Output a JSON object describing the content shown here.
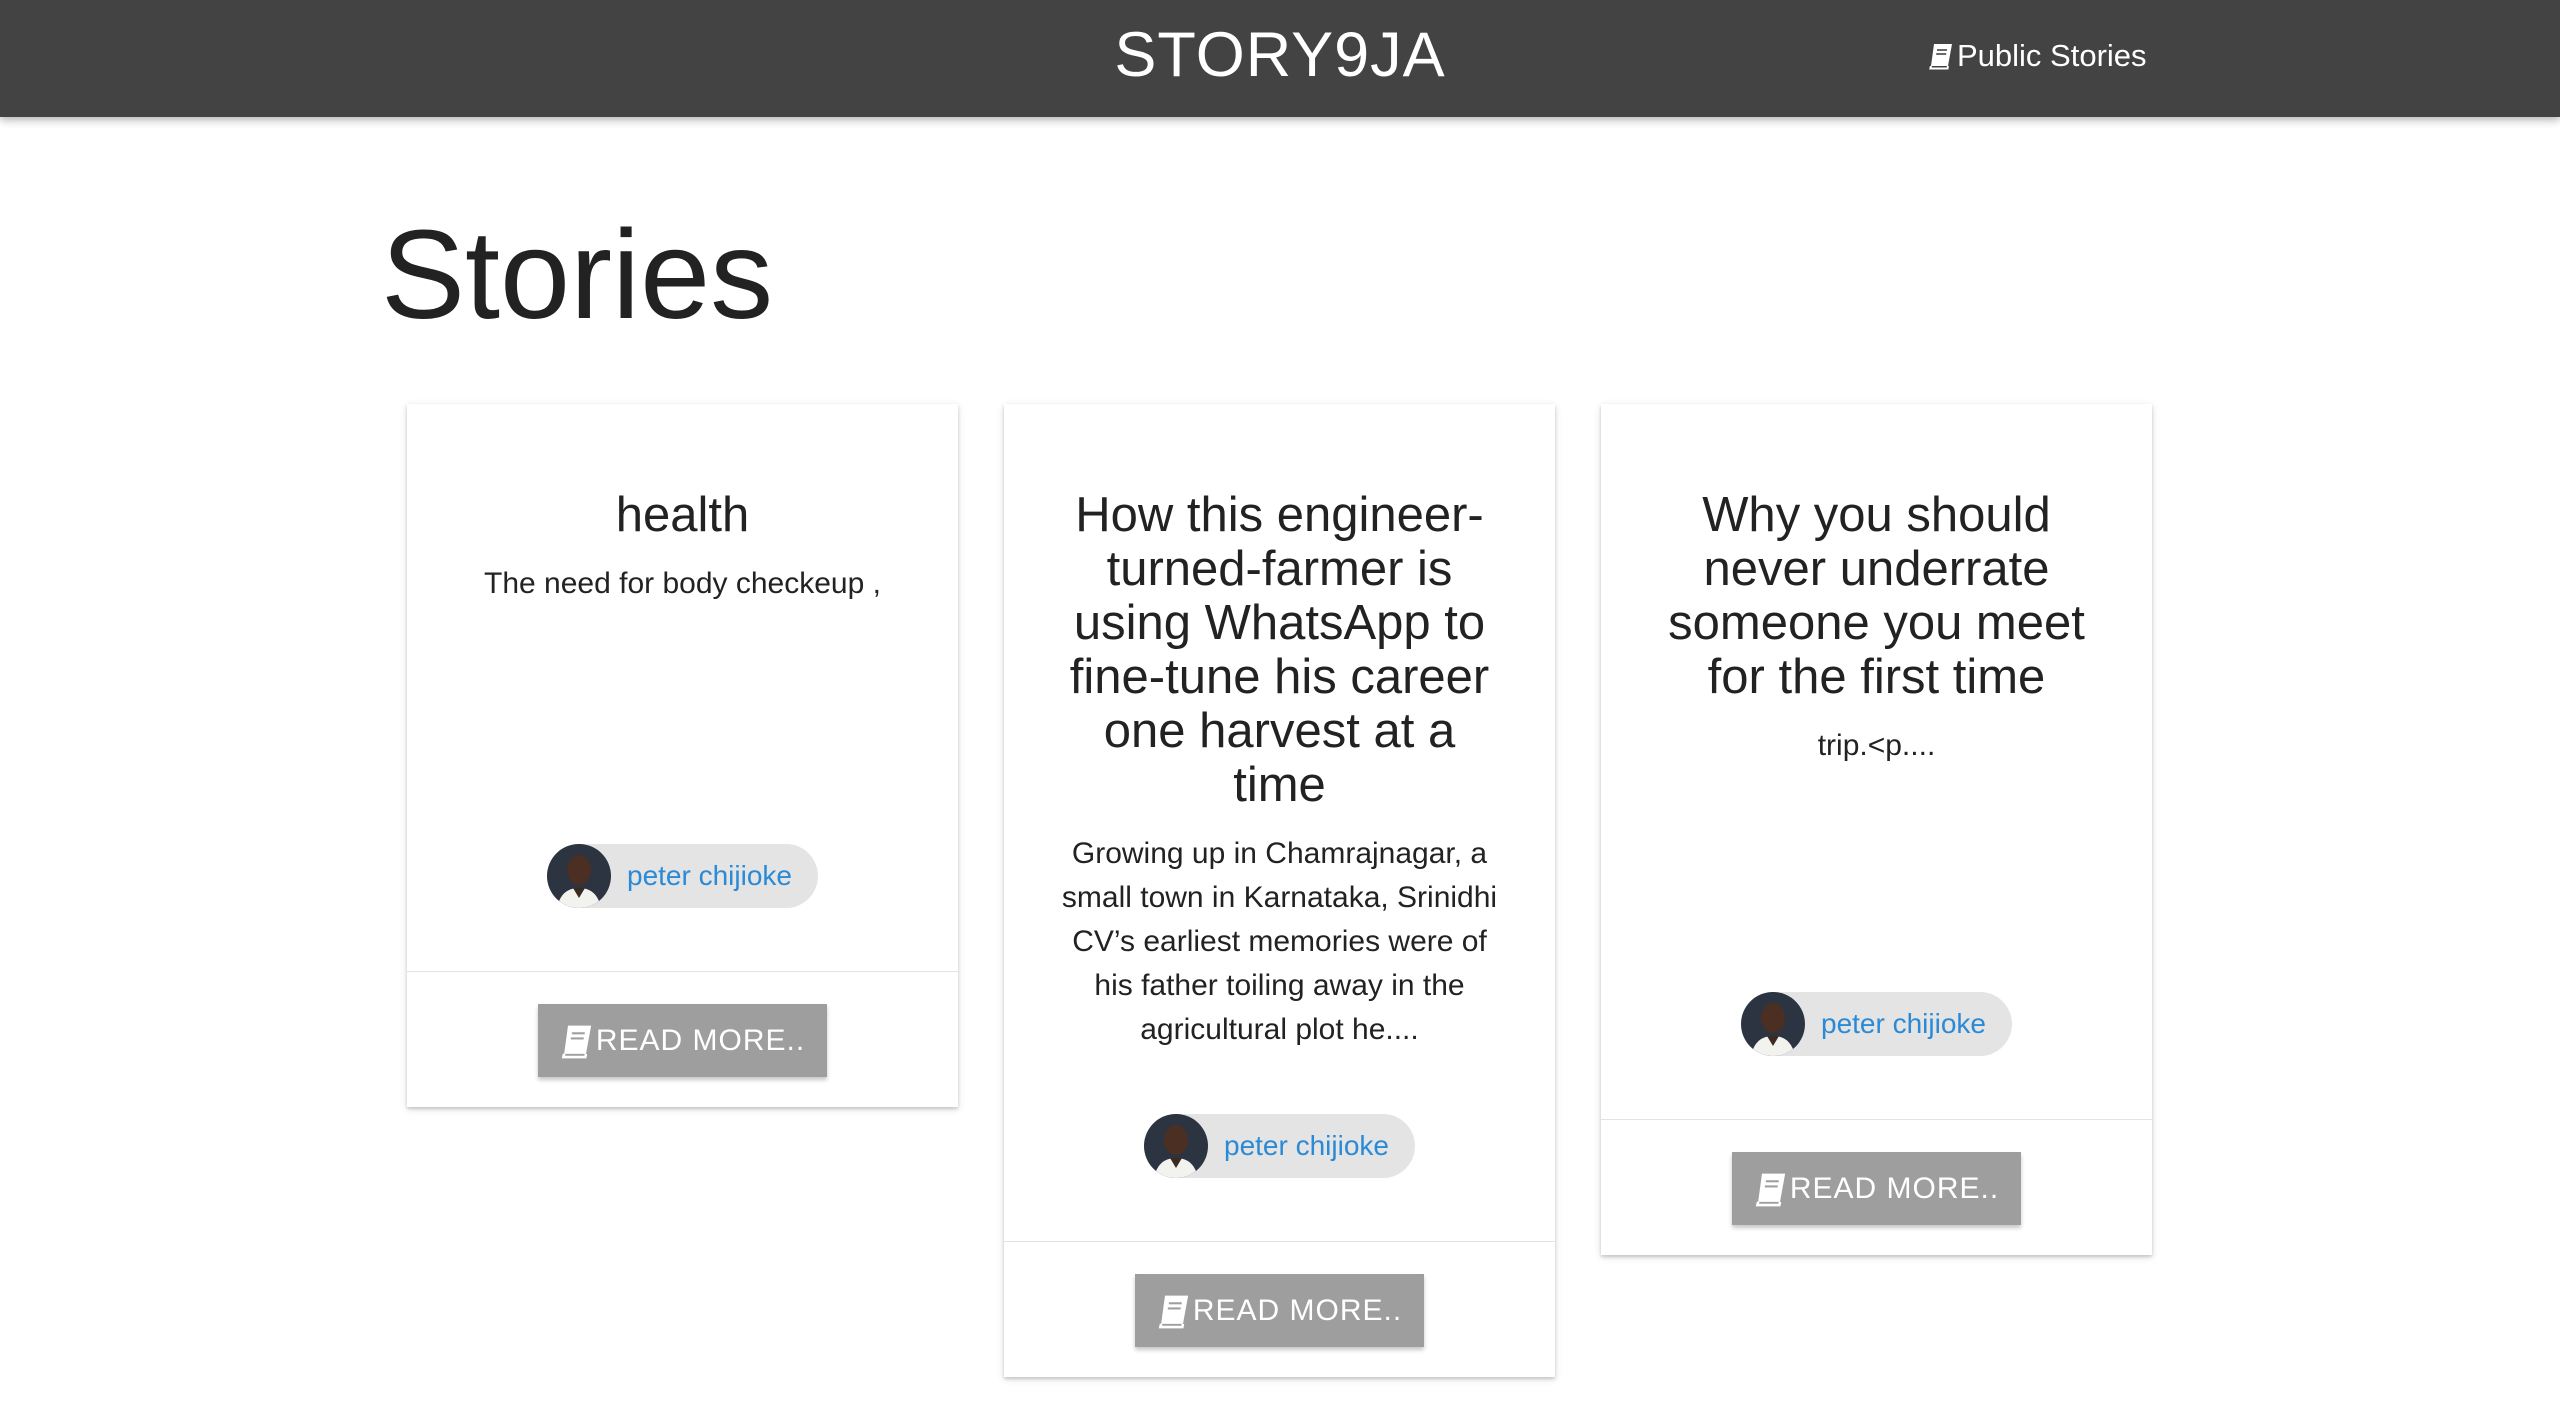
{
  "nav": {
    "brand": "STORY9JA",
    "public_stories_label": "Public Stories",
    "icon": "book-icon"
  },
  "page": {
    "title": "Stories"
  },
  "stories": [
    {
      "title": "health",
      "excerpt": "The need for body checkeup ,",
      "author": "peter chijioke",
      "read_more_label": "READ MORE.."
    },
    {
      "title": "How this engineer-turned-farmer is using WhatsApp to fine-tune his career one harvest at a time",
      "excerpt": "Growing up in Chamrajnagar, a small town in Karnataka, Srinidhi CV’s earliest memories were of his father toiling away in the agricultural plot he....",
      "author": "peter chijioke",
      "read_more_label": "READ MORE.."
    },
    {
      "title": "Why you should never underrate someone you meet for the first time",
      "excerpt": "trip.<p....",
      "author": "peter chijioke",
      "read_more_label": "READ MORE.."
    }
  ],
  "colors": {
    "navbar_bg": "#434343",
    "button_bg": "#9e9e9e",
    "author_link": "#2b8ad6",
    "chip_bg": "#e4e4e4"
  }
}
